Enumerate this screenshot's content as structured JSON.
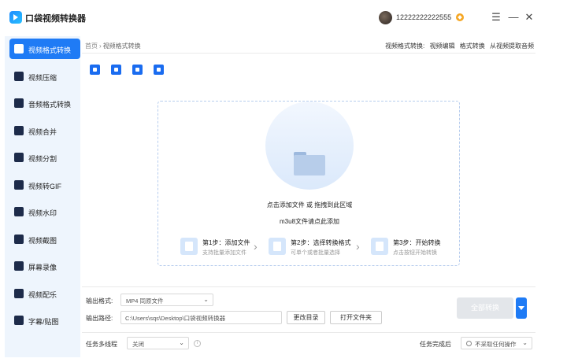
{
  "app": {
    "title": "口袋视频转换器",
    "username": "12222222222555"
  },
  "window": {
    "menu_icon": "☰",
    "minimize_icon": "—",
    "close_icon": "✕"
  },
  "sidebar": {
    "items": [
      {
        "label": "视频格式转换",
        "active": true
      },
      {
        "label": "视频压缩"
      },
      {
        "label": "音频格式转换"
      },
      {
        "label": "视频合并"
      },
      {
        "label": "视频分割"
      },
      {
        "label": "视频转GIF"
      },
      {
        "label": "视频水印"
      },
      {
        "label": "视频截图"
      },
      {
        "label": "屏幕录像"
      },
      {
        "label": "视频配乐"
      },
      {
        "label": "字幕/贴图"
      }
    ]
  },
  "breadcrumb": {
    "home": "首页",
    "sep": "›",
    "current": "视频格式转换"
  },
  "top_links": {
    "prefix": "视频格式转换:",
    "items": [
      "视频编辑",
      "格式转换",
      "从视频提取音频"
    ]
  },
  "toolbar": {
    "icons": [
      "add-file-icon",
      "add-folder-icon",
      "batch-icon",
      "m3u8-icon"
    ]
  },
  "dropzone": {
    "line1": "点击添加文件 或 拖拽到此区域",
    "line2": "m3u8文件请点此添加",
    "steps": [
      {
        "title": "第1步：添加文件",
        "sub": "支持批量添加文件"
      },
      {
        "title": "第2步：选择转换格式",
        "sub": "可单个或者批量选择"
      },
      {
        "title": "第3步：开始转换",
        "sub": "点击按钮开始转换"
      }
    ],
    "arrow": "›"
  },
  "output": {
    "format_label": "输出格式:",
    "format_value": "MP4  同原文件",
    "path_label": "输出路径:",
    "path_value": "C:\\Users\\sqs\\Desktop\\口袋视频转换器",
    "change_dir": "更改目录",
    "open_folder": "打开文件夹",
    "convert_all": "全部转换"
  },
  "task": {
    "threads_label": "任务多线程",
    "threads_value": "关闭",
    "after_label": "任务完成后",
    "after_value": "不采取任何操作"
  },
  "colors": {
    "accent": "#1f7bf5",
    "sidebar_bg": "#eef5fd",
    "vip": "#f5a623"
  }
}
